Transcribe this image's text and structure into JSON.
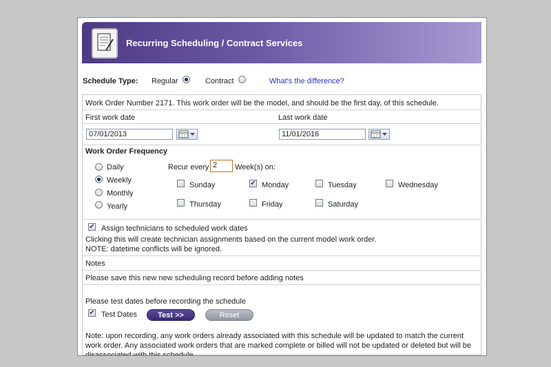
{
  "header": {
    "title": "Recurring Scheduling / Contract Services",
    "icon": "document-pencil-icon"
  },
  "schedule_type": {
    "label": "Schedule Type:",
    "options": [
      {
        "label": "Regular",
        "selected": true
      },
      {
        "label": "Contract",
        "selected": false
      }
    ],
    "difference_link": "What's the difference?"
  },
  "work_order_info": "Work Order Number 2171. This work order will be the model, and should be the first day, of this schedule.",
  "dates": {
    "first_label": "First work date",
    "first_value": "07/01/2013",
    "last_label": "Last work date",
    "last_value": "11/01/2016",
    "calendar_icon": "calendar-icon"
  },
  "frequency": {
    "title": "Work Order Frequency",
    "options": [
      {
        "label": "Daily",
        "selected": false
      },
      {
        "label": "Weekly",
        "selected": true
      },
      {
        "label": "Monthly",
        "selected": false
      },
      {
        "label": "Yearly",
        "selected": false
      }
    ],
    "recur_label": "Recur every",
    "recur_value": "2",
    "recur_suffix": "Week(s) on:",
    "days": [
      {
        "label": "Sunday",
        "checked": false
      },
      {
        "label": "Monday",
        "checked": true
      },
      {
        "label": "Tuesday",
        "checked": false
      },
      {
        "label": "Wednesday",
        "checked": false
      },
      {
        "label": "Thursday",
        "checked": false
      },
      {
        "label": "Friday",
        "checked": false
      },
      {
        "label": "Saturday",
        "checked": false
      }
    ]
  },
  "assign": {
    "label": "Assign technicians to scheduled work dates",
    "checked": true,
    "note1": "Clicking this will create technician assignments based on the current model work order.",
    "note2": "NOTE: datetime conflicts will be ignored."
  },
  "notes": {
    "title": "Notes",
    "message": "Please save this new new scheduling record before adding notes"
  },
  "test": {
    "prompt": "Please test dates before recording the schedule",
    "checkbox_label": "Test Dates",
    "checked": true,
    "test_button": "Test >>",
    "reset_button": "Reset"
  },
  "footer_note": "Note: upon recording, any work orders already associated with this schedule will be updated to match the current work order. Any associated work orders that are marked complete or billed will not be updated or deleted but will be disassociated with this schedule.",
  "colors": {
    "header_start": "#4e3a85",
    "header_end": "#a79bd3",
    "link": "#2333c9"
  }
}
